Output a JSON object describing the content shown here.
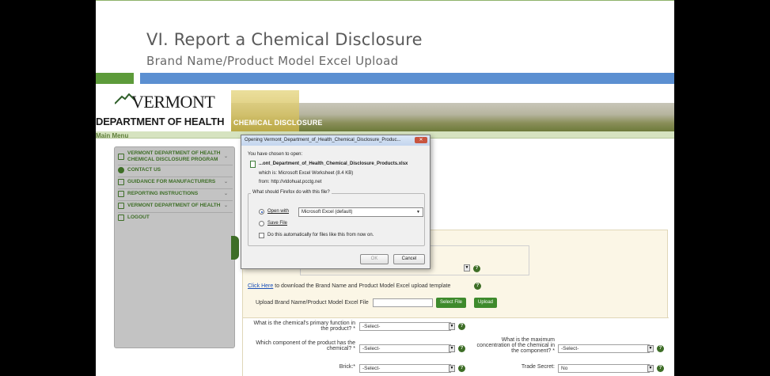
{
  "slide": {
    "title": "VI. Report a Chemical Disclosure",
    "subtitle": "Brand Name/Product Model Excel Upload"
  },
  "site": {
    "logo_text": "VERMONT",
    "dept_text": "DEPARTMENT OF HEALTH",
    "banner_label": "CHEMICAL DISCLOSURE",
    "main_menu": "Main Menu",
    "sidebar": [
      {
        "label": "VERMONT DEPARTMENT OF HEALTH CHEMICAL DISCLOSURE PROGRAM"
      },
      {
        "label": "CONTACT US"
      },
      {
        "label": "GUIDANCE FOR MANUFACTURERS"
      },
      {
        "label": "REPORTING INSTRUCTIONS"
      },
      {
        "label": "VERMONT DEPARTMENT OF HEALTH"
      },
      {
        "label": "LOGOUT"
      }
    ],
    "form": {
      "click_here": "Click Here",
      "template_text": "to download the Brand Name and Product Model Excel upload template",
      "upload_label": "Upload Brand Name/Product Model Excel File",
      "select_file": "Select File",
      "upload": "Upload",
      "q_function": "What is the chemical's primary function in the product? *",
      "q_function_value": "-Select-",
      "q_component": "Which component of the product has the chemical? *",
      "q_component_value": "-Select-",
      "q_max": "What is the maximum concentration of the chemical in the component? *",
      "q_max_value": "-Select-",
      "q_brick": "Brick:*",
      "q_brick_value": "-Select-",
      "q_trade": "Trade Secret:",
      "q_trade_value": "No"
    }
  },
  "dialog": {
    "title": "Opening Vermont_Department_of_Health_Chemical_Disclosure_Produc...",
    "chosen": "You have chosen to open:",
    "filename": "...ont_Department_of_Health_Chemical_Disclosure_Products.xlsx",
    "which_is": "which is: Microsoft Excel Worksheet (8.4 KB)",
    "from": "from: http://vtdohuat.pcctg.net",
    "question": "What should Firefox do with this file?",
    "open_with": "Open with",
    "open_with_app": "Microsoft Excel (default)",
    "save_file": "Save File",
    "auto": "Do this automatically for files like this from now on.",
    "ok": "OK",
    "cancel": "Cancel"
  }
}
